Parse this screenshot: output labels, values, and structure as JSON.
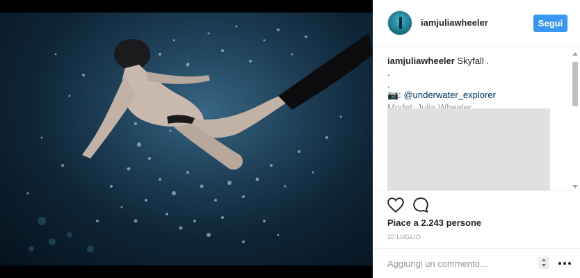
{
  "post": {
    "username": "iamjuliawheeler",
    "follow_label": "Segui",
    "caption": {
      "user": "iamjuliawheeler",
      "text": "Skyfall .",
      "dot_line_1": ".",
      "dot_line_2": ".",
      "camera_glyph": "📷:",
      "mention": "@underwater_explorer",
      "truncated_line": "Model: Julia Wheeler"
    },
    "likes_text": "Piace a 2.243 persone",
    "date_text": "20 LUGLIO",
    "comment_placeholder": "Aggiungi un commento..."
  },
  "icons": {
    "like": "heart-icon",
    "comment": "comment-icon",
    "options": "more-options-icon"
  },
  "colors": {
    "follow_button": "#3897f0",
    "mention": "#003569",
    "muted": "#999999"
  }
}
